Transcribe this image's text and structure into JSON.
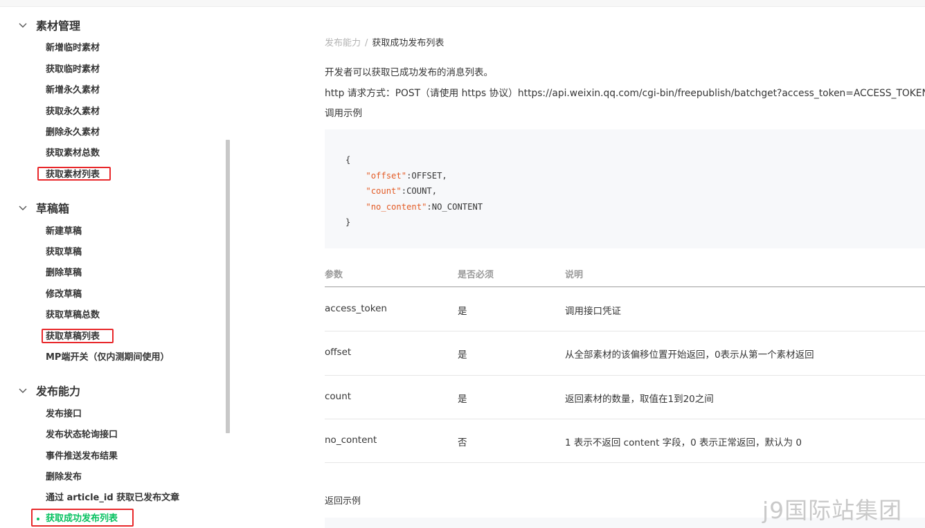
{
  "sidebar": {
    "groups": [
      {
        "title": "素材管理",
        "items": [
          "新增临时素材",
          "获取临时素材",
          "新增永久素材",
          "获取永久素材",
          "删除永久素材",
          "获取素材总数",
          "获取素材列表"
        ]
      },
      {
        "title": "草稿箱",
        "items": [
          "新建草稿",
          "获取草稿",
          "删除草稿",
          "修改草稿",
          "获取草稿总数",
          "获取草稿列表",
          "MP端开关（仅内测期间使用）"
        ]
      },
      {
        "title": "发布能力",
        "items": [
          "发布接口",
          "发布状态轮询接口",
          "事件推送发布结果",
          "删除发布",
          "通过 article_id 获取已发布文章",
          "获取成功发布列表"
        ]
      }
    ]
  },
  "breadcrumb": {
    "parent": "发布能力",
    "separator": "/",
    "current": "获取成功发布列表"
  },
  "intro": "开发者可以获取已成功发布的消息列表。",
  "http_line": "http 请求方式：POST（请使用 https 协议）https://api.weixin.qq.com/cgi-bin/freepublish/batchget?access_token=ACCESS_TOKEN",
  "call_example_label": "调用示例",
  "code_example": {
    "open": "{",
    "lines": [
      {
        "key": "\"offset\"",
        "value": ":OFFSET,"
      },
      {
        "key": "\"count\"",
        "value": ":COUNT,"
      },
      {
        "key": "\"no_content\"",
        "value": ":NO_CONTENT"
      }
    ],
    "close": "}"
  },
  "table": {
    "headers": [
      "参数",
      "是否必须",
      "说明"
    ],
    "rows": [
      [
        "access_token",
        "是",
        "调用接口凭证"
      ],
      [
        "offset",
        "是",
        "从全部素材的该偏移位置开始返回，0表示从第一个素材返回"
      ],
      [
        "count",
        "是",
        "返回素材的数量，取值在1到20之间"
      ],
      [
        "no_content",
        "否",
        "1 表示不返回 content 字段，0 表示正常返回，默认为 0"
      ]
    ]
  },
  "return_example_label": "返回示例",
  "watermark": "j9国际站集团",
  "colors": {
    "accent": "#07c160",
    "highlight": "#e8272a",
    "code_key": "#e35b25"
  }
}
